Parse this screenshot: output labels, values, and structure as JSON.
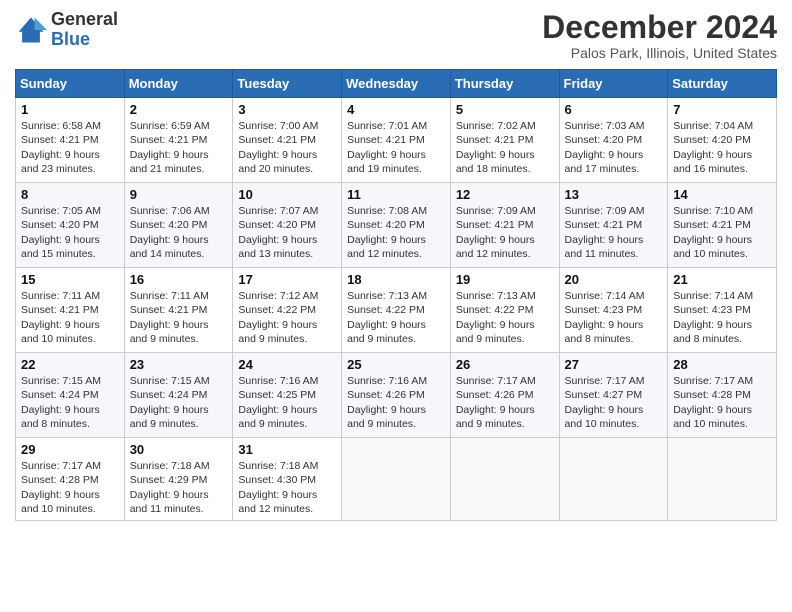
{
  "header": {
    "logo_general": "General",
    "logo_blue": "Blue",
    "month_title": "December 2024",
    "location": "Palos Park, Illinois, United States"
  },
  "weekdays": [
    "Sunday",
    "Monday",
    "Tuesday",
    "Wednesday",
    "Thursday",
    "Friday",
    "Saturday"
  ],
  "weeks": [
    [
      {
        "day": "1",
        "sunrise": "6:58 AM",
        "sunset": "4:21 PM",
        "daylight": "9 hours and 23 minutes."
      },
      {
        "day": "2",
        "sunrise": "6:59 AM",
        "sunset": "4:21 PM",
        "daylight": "9 hours and 21 minutes."
      },
      {
        "day": "3",
        "sunrise": "7:00 AM",
        "sunset": "4:21 PM",
        "daylight": "9 hours and 20 minutes."
      },
      {
        "day": "4",
        "sunrise": "7:01 AM",
        "sunset": "4:21 PM",
        "daylight": "9 hours and 19 minutes."
      },
      {
        "day": "5",
        "sunrise": "7:02 AM",
        "sunset": "4:21 PM",
        "daylight": "9 hours and 18 minutes."
      },
      {
        "day": "6",
        "sunrise": "7:03 AM",
        "sunset": "4:20 PM",
        "daylight": "9 hours and 17 minutes."
      },
      {
        "day": "7",
        "sunrise": "7:04 AM",
        "sunset": "4:20 PM",
        "daylight": "9 hours and 16 minutes."
      }
    ],
    [
      {
        "day": "8",
        "sunrise": "7:05 AM",
        "sunset": "4:20 PM",
        "daylight": "9 hours and 15 minutes."
      },
      {
        "day": "9",
        "sunrise": "7:06 AM",
        "sunset": "4:20 PM",
        "daylight": "9 hours and 14 minutes."
      },
      {
        "day": "10",
        "sunrise": "7:07 AM",
        "sunset": "4:20 PM",
        "daylight": "9 hours and 13 minutes."
      },
      {
        "day": "11",
        "sunrise": "7:08 AM",
        "sunset": "4:20 PM",
        "daylight": "9 hours and 12 minutes."
      },
      {
        "day": "12",
        "sunrise": "7:09 AM",
        "sunset": "4:21 PM",
        "daylight": "9 hours and 12 minutes."
      },
      {
        "day": "13",
        "sunrise": "7:09 AM",
        "sunset": "4:21 PM",
        "daylight": "9 hours and 11 minutes."
      },
      {
        "day": "14",
        "sunrise": "7:10 AM",
        "sunset": "4:21 PM",
        "daylight": "9 hours and 10 minutes."
      }
    ],
    [
      {
        "day": "15",
        "sunrise": "7:11 AM",
        "sunset": "4:21 PM",
        "daylight": "9 hours and 10 minutes."
      },
      {
        "day": "16",
        "sunrise": "7:11 AM",
        "sunset": "4:21 PM",
        "daylight": "9 hours and 9 minutes."
      },
      {
        "day": "17",
        "sunrise": "7:12 AM",
        "sunset": "4:22 PM",
        "daylight": "9 hours and 9 minutes."
      },
      {
        "day": "18",
        "sunrise": "7:13 AM",
        "sunset": "4:22 PM",
        "daylight": "9 hours and 9 minutes."
      },
      {
        "day": "19",
        "sunrise": "7:13 AM",
        "sunset": "4:22 PM",
        "daylight": "9 hours and 9 minutes."
      },
      {
        "day": "20",
        "sunrise": "7:14 AM",
        "sunset": "4:23 PM",
        "daylight": "9 hours and 8 minutes."
      },
      {
        "day": "21",
        "sunrise": "7:14 AM",
        "sunset": "4:23 PM",
        "daylight": "9 hours and 8 minutes."
      }
    ],
    [
      {
        "day": "22",
        "sunrise": "7:15 AM",
        "sunset": "4:24 PM",
        "daylight": "9 hours and 8 minutes."
      },
      {
        "day": "23",
        "sunrise": "7:15 AM",
        "sunset": "4:24 PM",
        "daylight": "9 hours and 9 minutes."
      },
      {
        "day": "24",
        "sunrise": "7:16 AM",
        "sunset": "4:25 PM",
        "daylight": "9 hours and 9 minutes."
      },
      {
        "day": "25",
        "sunrise": "7:16 AM",
        "sunset": "4:26 PM",
        "daylight": "9 hours and 9 minutes."
      },
      {
        "day": "26",
        "sunrise": "7:17 AM",
        "sunset": "4:26 PM",
        "daylight": "9 hours and 9 minutes."
      },
      {
        "day": "27",
        "sunrise": "7:17 AM",
        "sunset": "4:27 PM",
        "daylight": "9 hours and 10 minutes."
      },
      {
        "day": "28",
        "sunrise": "7:17 AM",
        "sunset": "4:28 PM",
        "daylight": "9 hours and 10 minutes."
      }
    ],
    [
      {
        "day": "29",
        "sunrise": "7:17 AM",
        "sunset": "4:28 PM",
        "daylight": "9 hours and 10 minutes."
      },
      {
        "day": "30",
        "sunrise": "7:18 AM",
        "sunset": "4:29 PM",
        "daylight": "9 hours and 11 minutes."
      },
      {
        "day": "31",
        "sunrise": "7:18 AM",
        "sunset": "4:30 PM",
        "daylight": "9 hours and 12 minutes."
      },
      null,
      null,
      null,
      null
    ]
  ]
}
